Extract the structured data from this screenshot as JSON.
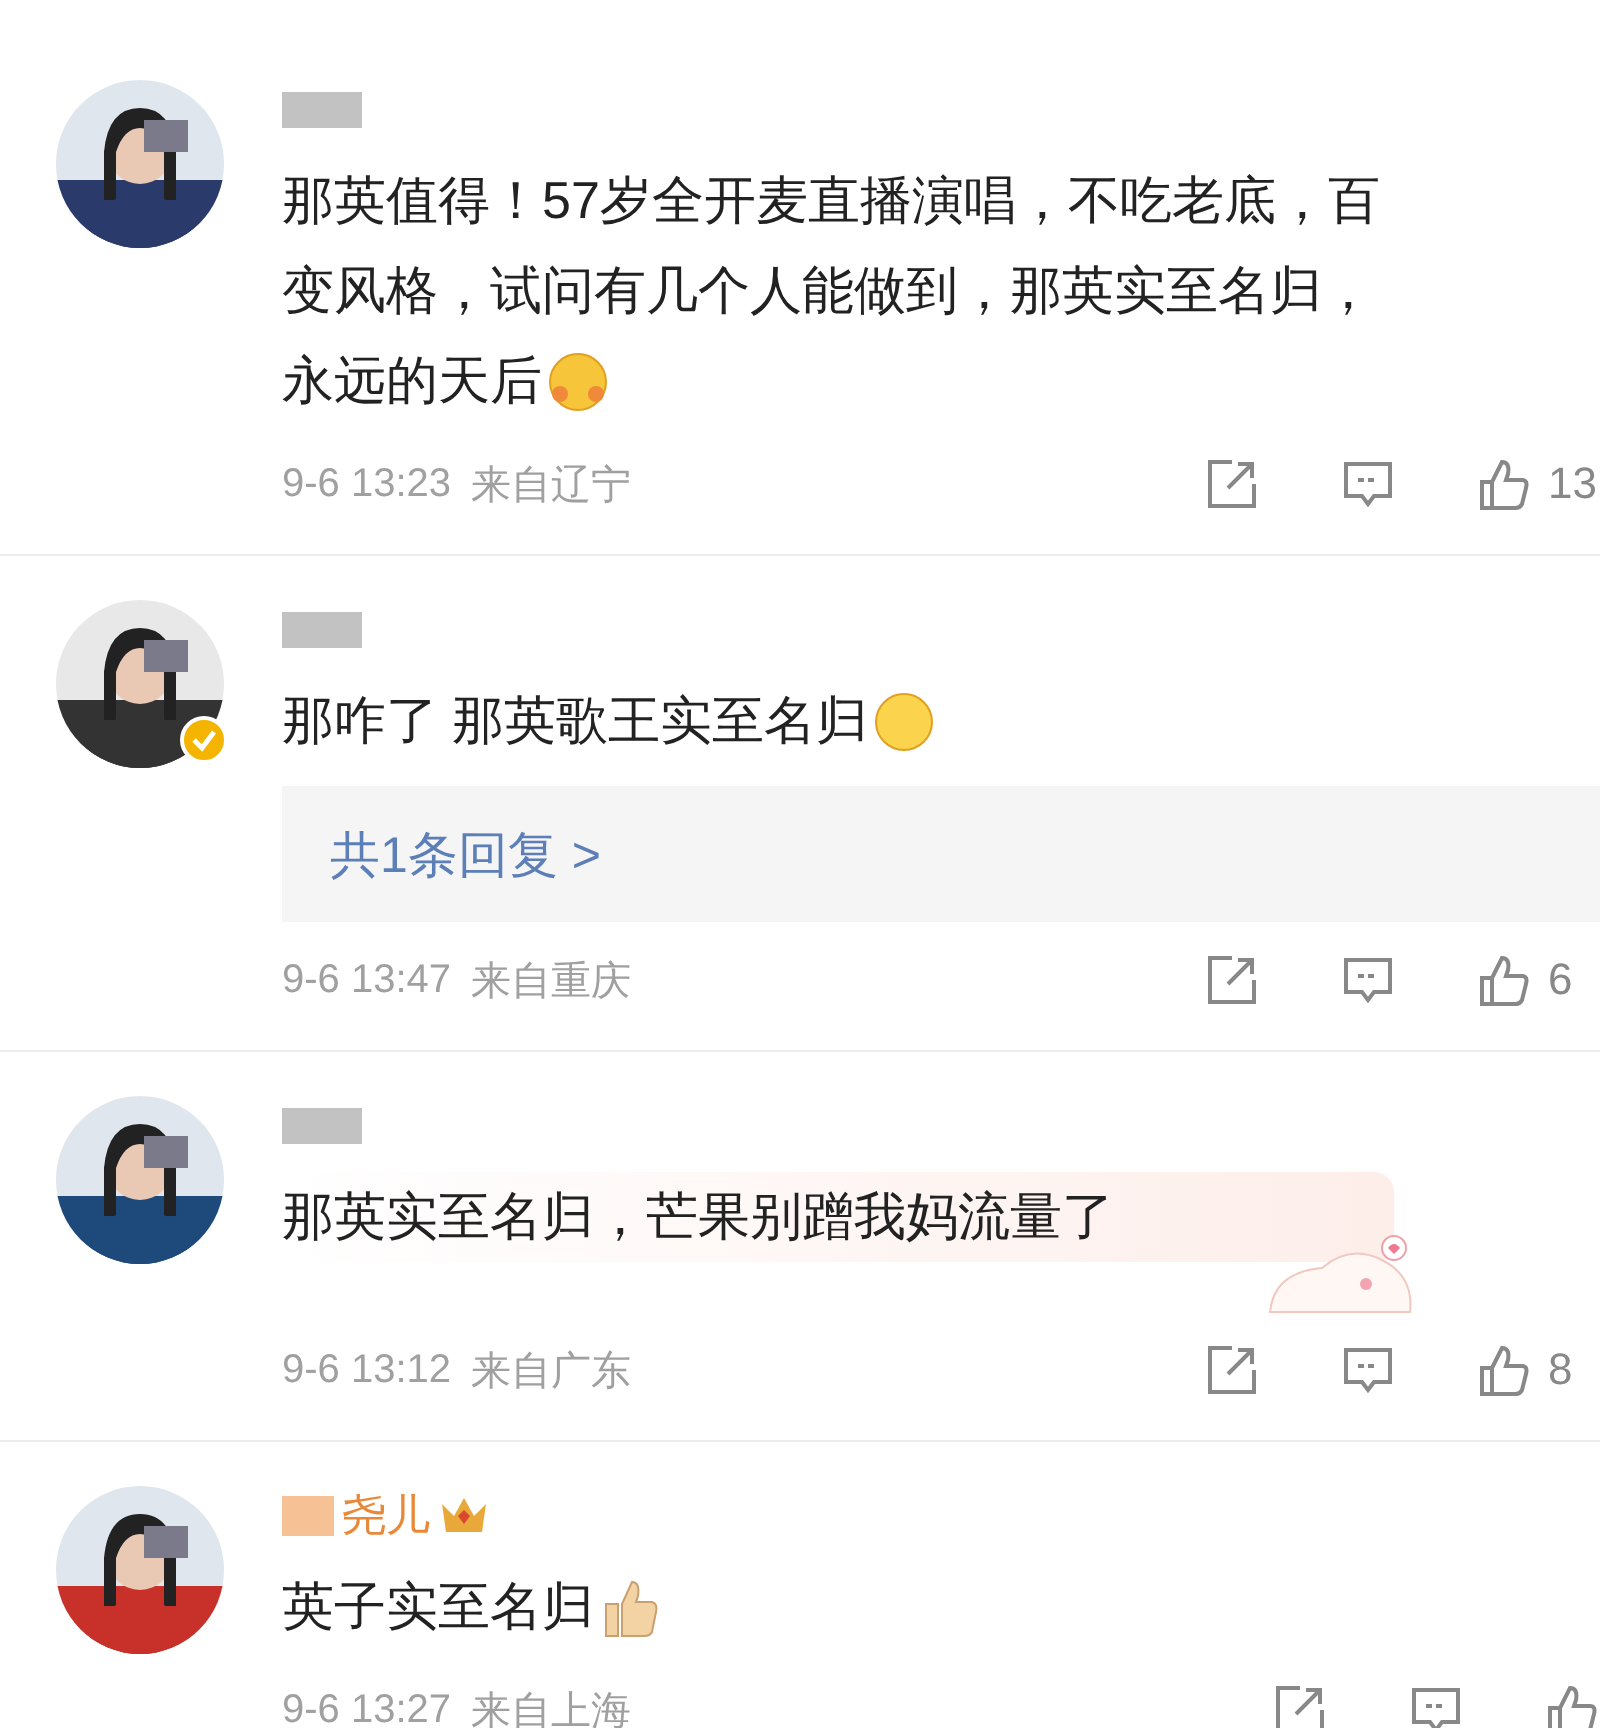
{
  "comments": [
    {
      "avatar": {
        "kind": "picture"
      },
      "verified": false,
      "text_lines": [
        "那英值得！57岁全开麦直播演唱，不吃老底，百",
        "变风格，试问有几个人能做到，那英实至名归，",
        "永远的天后"
      ],
      "emoji": {
        "kind": "hug"
      },
      "time": "9-6 13:23",
      "location": "来自辽宁",
      "likes": "13"
    },
    {
      "avatar": {
        "kind": "picture"
      },
      "verified": true,
      "text_lines": [
        "那咋了 那英歌王实至名归"
      ],
      "emoji": {
        "kind": "kiss"
      },
      "reply_link": "共1条回复 >",
      "time": "9-6 13:47",
      "location": "来自重庆",
      "likes": "6"
    },
    {
      "avatar": {
        "kind": "picture"
      },
      "verified": false,
      "sticker": true,
      "text_lines": [
        "那英实至名归，芒果别蹭我妈流量了"
      ],
      "time": "9-6 13:12",
      "location": "来自广东",
      "likes": "8"
    },
    {
      "avatar": {
        "kind": "picture"
      },
      "verified": false,
      "username": "尧儿",
      "crown": true,
      "text_lines": [
        "英子实至名归"
      ],
      "emoji": {
        "kind": "thumbs_up"
      },
      "time": "9-6 13:27",
      "location": "来自上海"
    }
  ]
}
